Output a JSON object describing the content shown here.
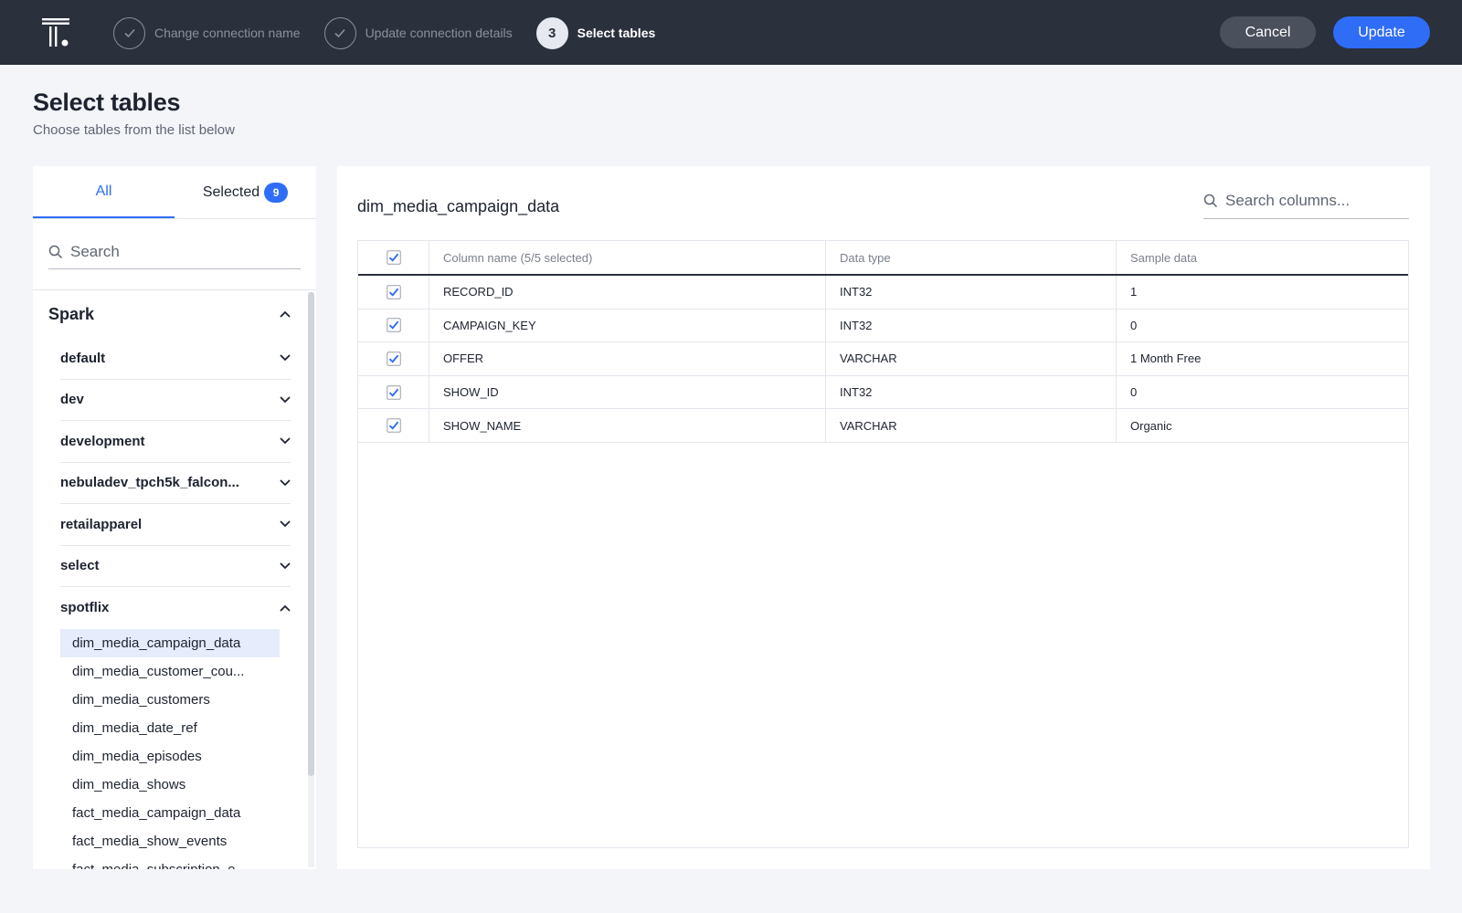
{
  "steps": [
    {
      "label": "Change connection name",
      "state": "done"
    },
    {
      "label": "Update connection details",
      "state": "done"
    },
    {
      "number": "3",
      "label": "Select tables",
      "state": "active"
    }
  ],
  "actions": {
    "cancel_label": "Cancel",
    "update_label": "Update"
  },
  "header": {
    "title": "Select tables",
    "subtitle": "Choose tables from the list below"
  },
  "sidebar": {
    "tabs": {
      "all_label": "All",
      "selected_label": "Selected",
      "selected_count": "9"
    },
    "search_placeholder": "Search",
    "root": {
      "label": "Spark",
      "expanded": true
    },
    "schemas": [
      {
        "label": "default"
      },
      {
        "label": "dev"
      },
      {
        "label": "development"
      },
      {
        "label": "nebuladev_tpch5k_falcon..."
      },
      {
        "label": "retailapparel"
      },
      {
        "label": "select"
      },
      {
        "label": "spotflix"
      }
    ],
    "tables": [
      "dim_media_campaign_data",
      "dim_media_customer_cou...",
      "dim_media_customers",
      "dim_media_date_ref",
      "dim_media_episodes",
      "dim_media_shows",
      "fact_media_campaign_data",
      "fact_media_show_events",
      "fact_media_subscription_e..."
    ],
    "selected_table": "dim_media_campaign_data"
  },
  "main": {
    "table_name": "dim_media_campaign_data",
    "column_search_placeholder": "Search columns...",
    "headers": {
      "column_name": "Column name (5/5 selected)",
      "data_type": "Data type",
      "sample_data": "Sample data"
    },
    "rows": [
      {
        "name": "RECORD_ID",
        "type": "INT32",
        "sample": "1",
        "checked": true
      },
      {
        "name": "CAMPAIGN_KEY",
        "type": "INT32",
        "sample": "0",
        "checked": true
      },
      {
        "name": "OFFER",
        "type": "VARCHAR",
        "sample": "1 Month Free",
        "checked": true
      },
      {
        "name": "SHOW_ID",
        "type": "INT32",
        "sample": "0",
        "checked": true
      },
      {
        "name": "SHOW_NAME",
        "type": "VARCHAR",
        "sample": "Organic",
        "checked": true
      }
    ]
  },
  "colors": {
    "accent": "#2f6df6",
    "topbar": "#2a303c",
    "background": "#f4f5f9",
    "selected_row": "#e6ecfb"
  }
}
